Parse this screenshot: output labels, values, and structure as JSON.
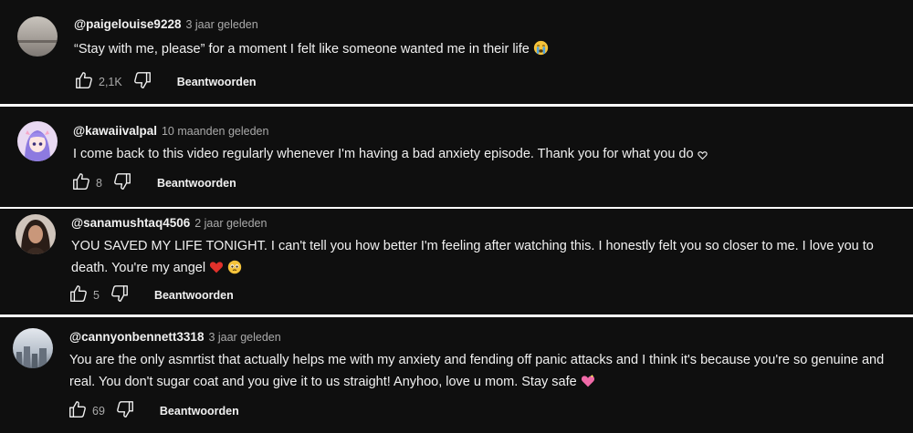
{
  "comments": [
    {
      "handle": "@paigelouise9228",
      "time": "3 jaar geleden",
      "text": "“Stay with me, please” for a moment I felt like someone wanted me in their life",
      "emoji": "crying-face",
      "likes": "2,1K",
      "reply_label": "Beantwoorden",
      "avatar": "grey-landscape-avatar"
    },
    {
      "handle": "@kawaiivalpal",
      "time": "10 maanden geleden",
      "text": "I come back to this video regularly whenever I'm having a bad anxiety episode. Thank you for what you do",
      "emoji": "white-heart-outline",
      "likes": "8",
      "reply_label": "Beantwoorden",
      "avatar": "anime-girl-avatar"
    },
    {
      "handle": "@sanamushtaq4506",
      "time": "2 jaar geleden",
      "text": "YOU SAVED MY LIFE TONIGHT. I can't tell you how better I'm feeling after watching this. I honestly felt you so closer to me. I love you to death. You're my angel",
      "emoji": "red-heart + pleading-face",
      "likes": "5",
      "reply_label": "Beantwoorden",
      "avatar": "woman-portrait-avatar"
    },
    {
      "handle": "@cannyonbennett3318",
      "time": "3 jaar geleden",
      "text": "You are the only asmrtist that actually helps me with my anxiety and fending off panic attacks and I think it's because you're so genuine and real. You don't sugar coat and you give it to us straight! Anyhoo, love u mom. Stay safe",
      "emoji": "sparkling-heart",
      "likes": "69",
      "reply_label": "Beantwoorden",
      "avatar": "city-sky-avatar"
    }
  ],
  "colors": {
    "background": "#0f0f0f",
    "separator": "#ffffff",
    "text": "#f1f1f1",
    "meta": "#aaaaaa"
  }
}
